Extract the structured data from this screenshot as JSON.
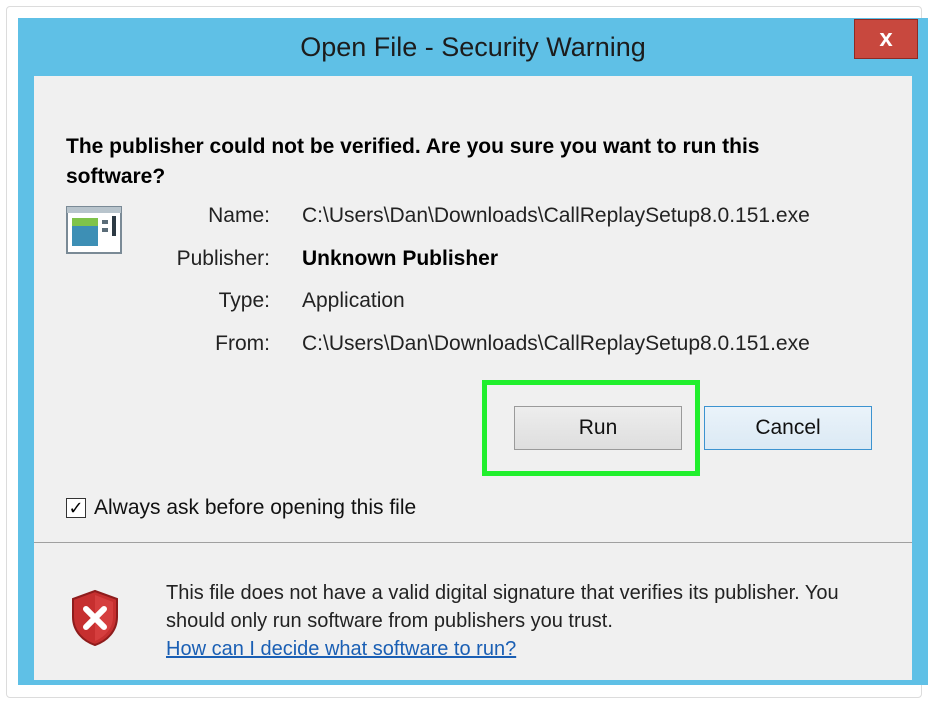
{
  "window": {
    "title": "Open File - Security Warning",
    "close_label": "x"
  },
  "dialog": {
    "heading": "The publisher could not be verified.  Are you sure you want to run this software?",
    "icon": "application-file-icon",
    "fields": {
      "name_label": "Name:",
      "name_value": "C:\\Users\\Dan\\Downloads\\CallReplaySetup8.0.151.exe",
      "publisher_label": "Publisher:",
      "publisher_value": "Unknown Publisher",
      "type_label": "Type:",
      "type_value": "Application",
      "from_label": "From:",
      "from_value": "C:\\Users\\Dan\\Downloads\\CallReplaySetup8.0.151.exe"
    },
    "buttons": {
      "run_label": "Run",
      "cancel_label": "Cancel"
    },
    "checkbox": {
      "label": "Always ask before opening this file",
      "checked": true
    }
  },
  "footer": {
    "icon": "warning-shield-icon",
    "warning_text": "This file does not have a valid digital signature that verifies its publisher.  You should only run software from publishers you trust.",
    "help_link": "How can I decide what software to run?"
  },
  "colors": {
    "title_bar": "#5fc0e6",
    "close_button": "#c8483e",
    "highlight": "#21ef2d",
    "client_background": "#f0f0f0",
    "link": "#1a5fb4"
  }
}
